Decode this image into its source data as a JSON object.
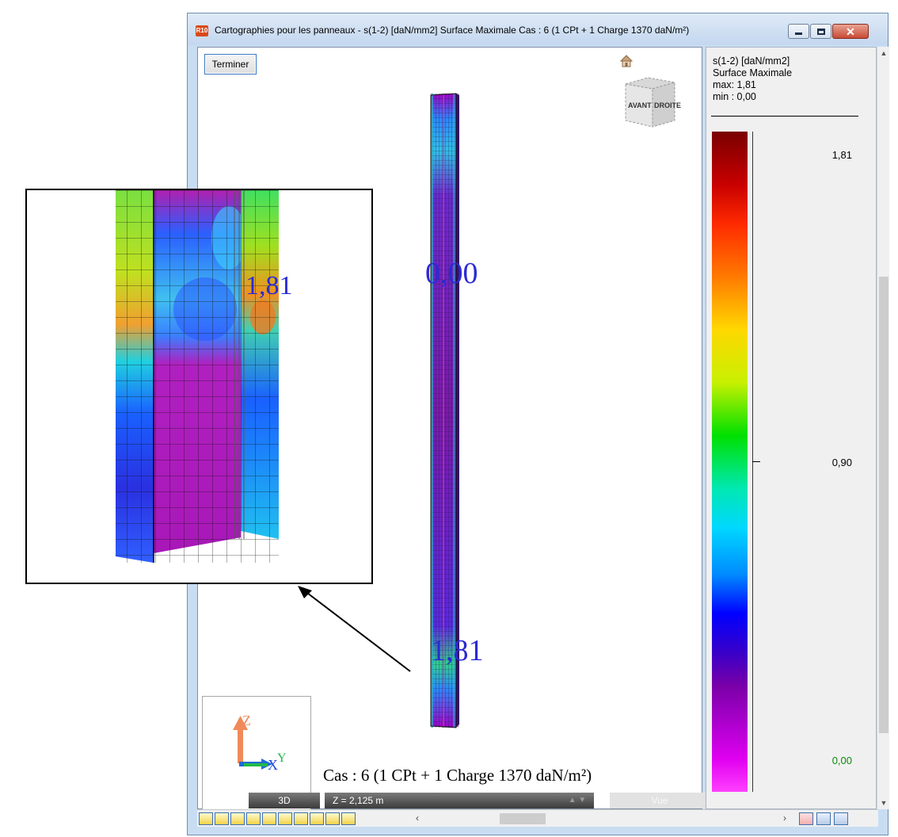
{
  "window": {
    "title": "Cartographies pour les panneaux - s(1-2) [daN/mm2] Surface Maximale Cas : 6 (1 CPt + 1 Charge 1370 daN/m²)",
    "app_icon_text": "R10"
  },
  "viewport": {
    "terminer_label": "Terminer",
    "viewcube_front": "AVANT",
    "viewcube_right": "DROITE",
    "label_top": "0,00",
    "label_bottom": "1,81",
    "case_label": "Cas : 6 (1 CPt + 1 Charge 1370 daN/m²)",
    "axes": {
      "z": "Z",
      "x": "X",
      "y": "Y"
    }
  },
  "status": {
    "mode": "3D",
    "z_level": "Z = 2,125 m",
    "view": "Vue"
  },
  "legend": {
    "quantity": "s(1-2) [daN/mm2]",
    "surface": "Surface Maximale",
    "max_line": "max: 1,81",
    "min_line": "min : 0,00",
    "value_max": "1,81",
    "value_mid": "0,90",
    "value_min": "0,00"
  },
  "zoom_inset": {
    "label": "1,81"
  },
  "icons": [
    "app-icon",
    "home-icon",
    "viewcube-icon",
    "minimize-icon",
    "maximize-icon",
    "close-icon",
    "scroll-up-icon",
    "scroll-down-icon",
    "scroll-left-icon",
    "scroll-right-icon"
  ]
}
